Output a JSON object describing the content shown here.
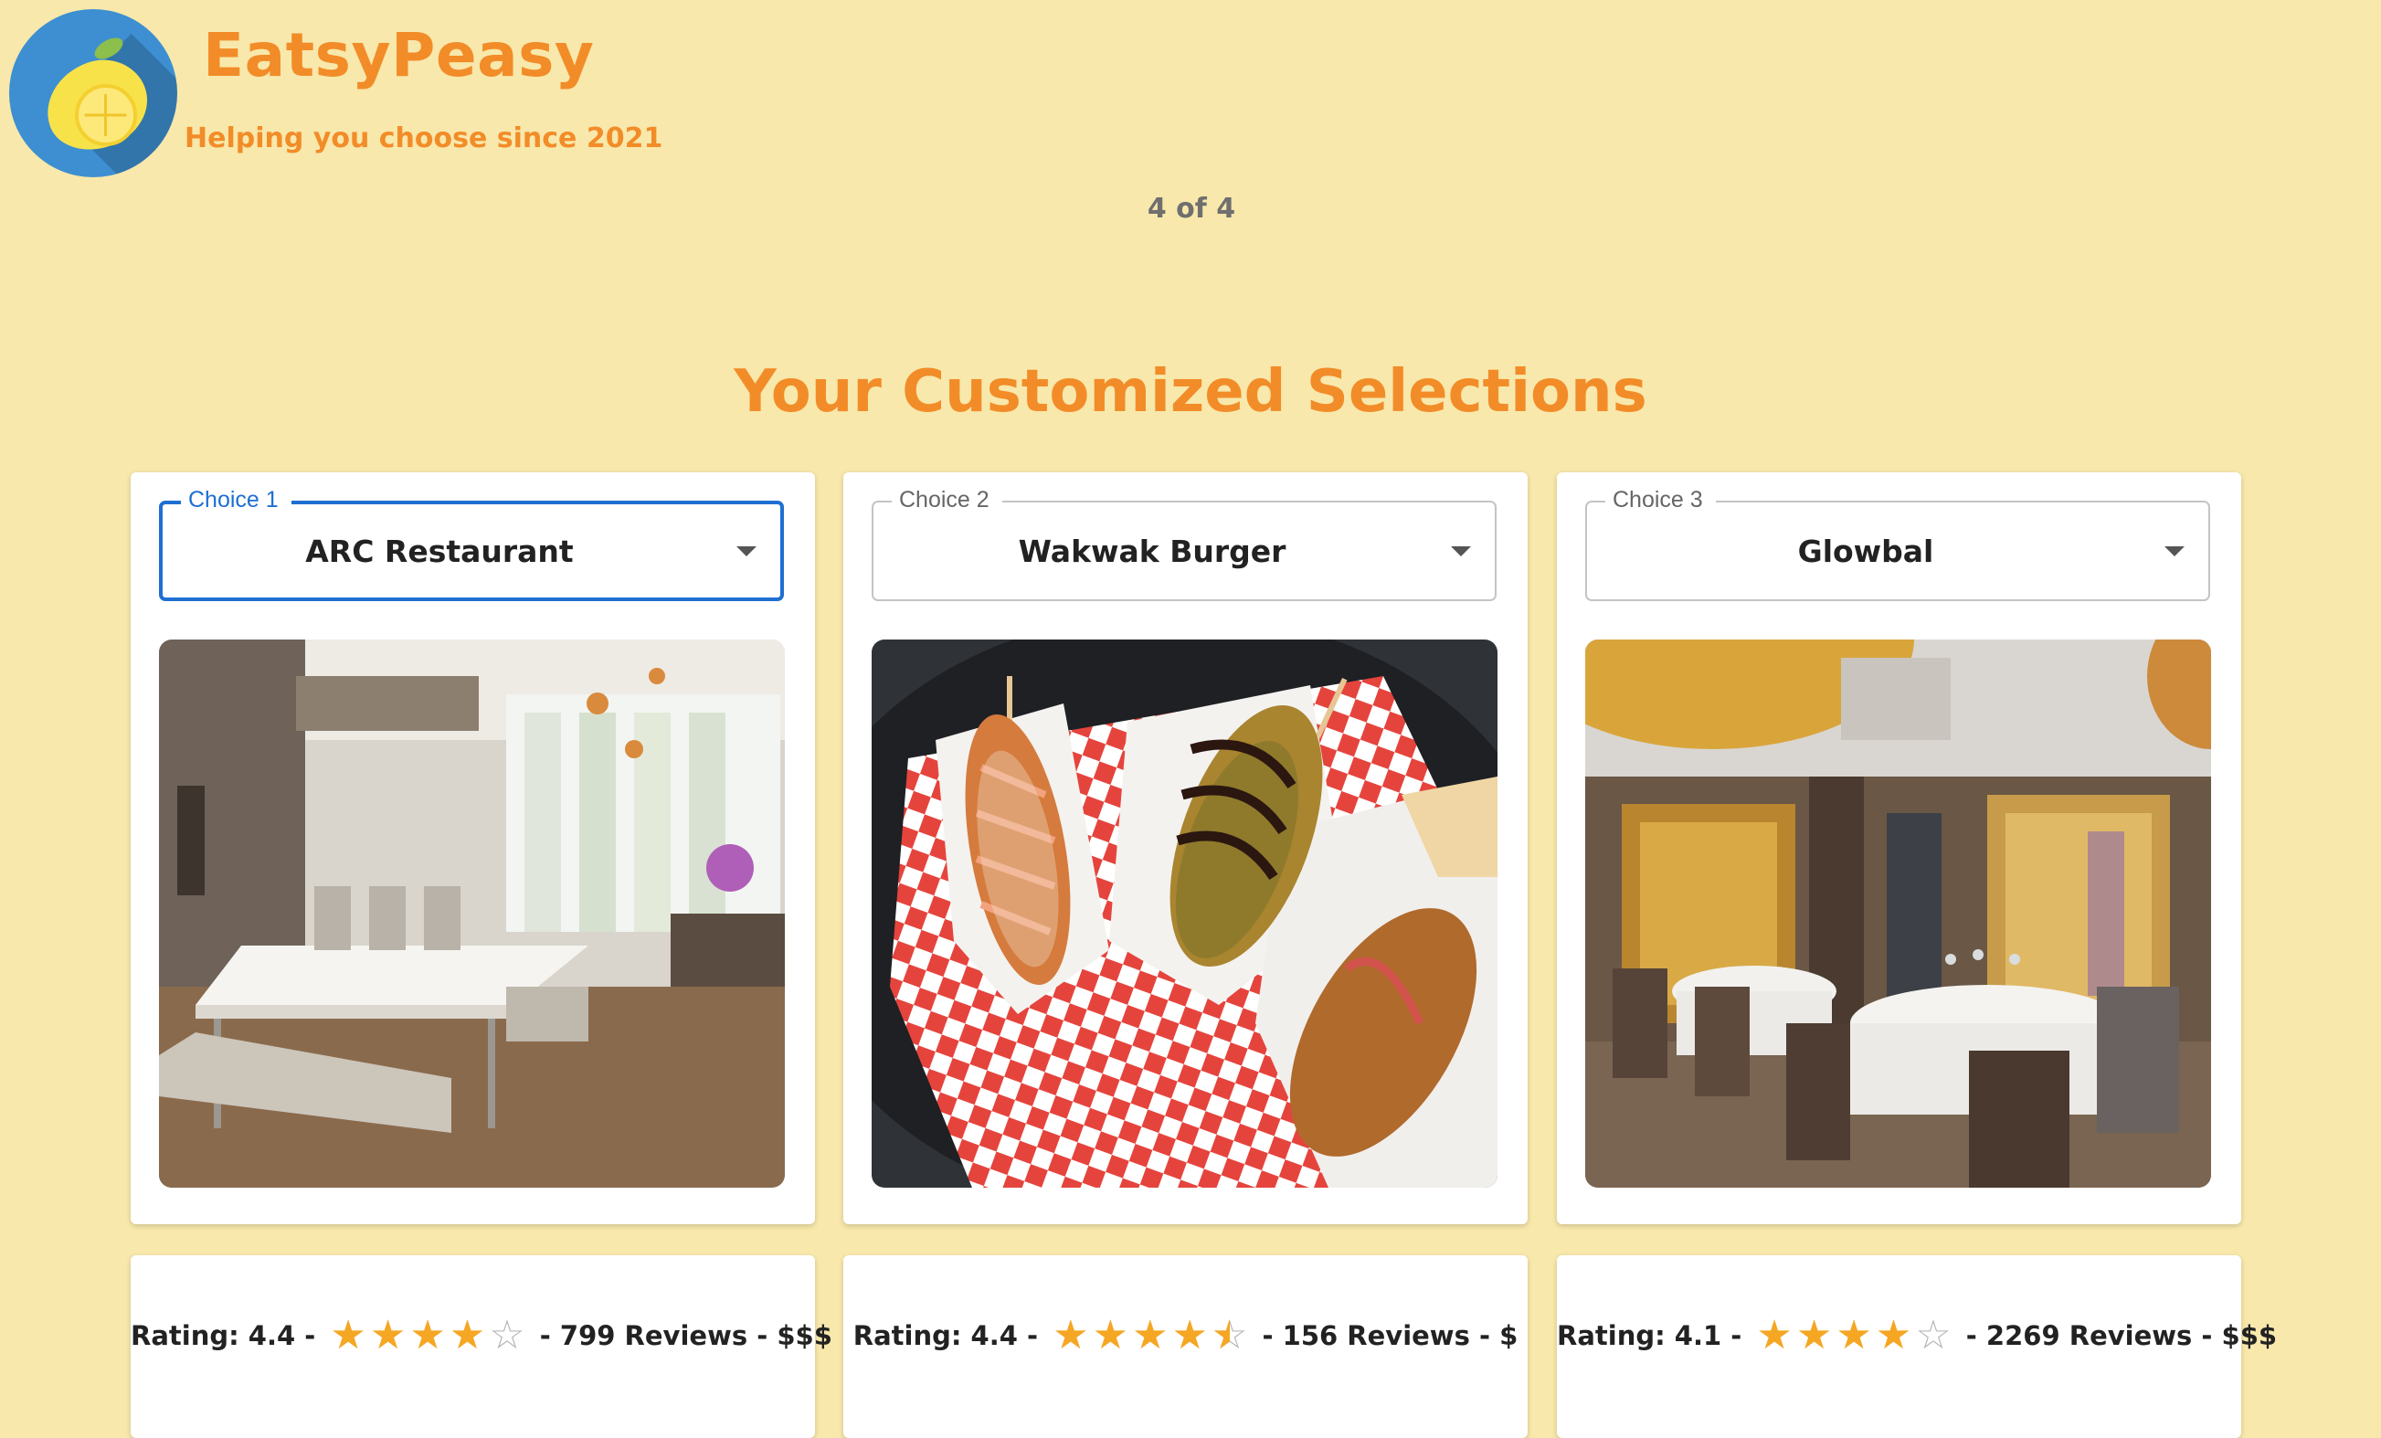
{
  "header": {
    "brand": "EatsyPeasy",
    "tagline": "Helping you choose since 2021",
    "logo_icon": "lemon-logo-icon"
  },
  "pager": {
    "text": "4 of 4"
  },
  "section_title": "Your Customized Selections",
  "colors": {
    "background": "#f8e8ab",
    "accent": "#f28c28",
    "focus": "#1f6fd2",
    "star": "#f5a623"
  },
  "choices": [
    {
      "label": "Choice 1",
      "value": "ARC Restaurant",
      "image_icon": "restaurant-interior-photo",
      "rating_text": "Rating: 4.4 -",
      "stars": 4,
      "reviews_text": "- 799 Reviews - $$$"
    },
    {
      "label": "Choice 2",
      "value": "Wakwak Burger",
      "image_icon": "corn-dog-food-photo",
      "rating_text": "Rating: 4.4 -",
      "stars": 4.5,
      "reviews_text": "- 156 Reviews - $"
    },
    {
      "label": "Choice 3",
      "value": "Glowbal",
      "image_icon": "dining-room-photo",
      "rating_text": "Rating: 4.1 -",
      "stars": 4,
      "reviews_text": "- 2269 Reviews - $$$"
    }
  ]
}
